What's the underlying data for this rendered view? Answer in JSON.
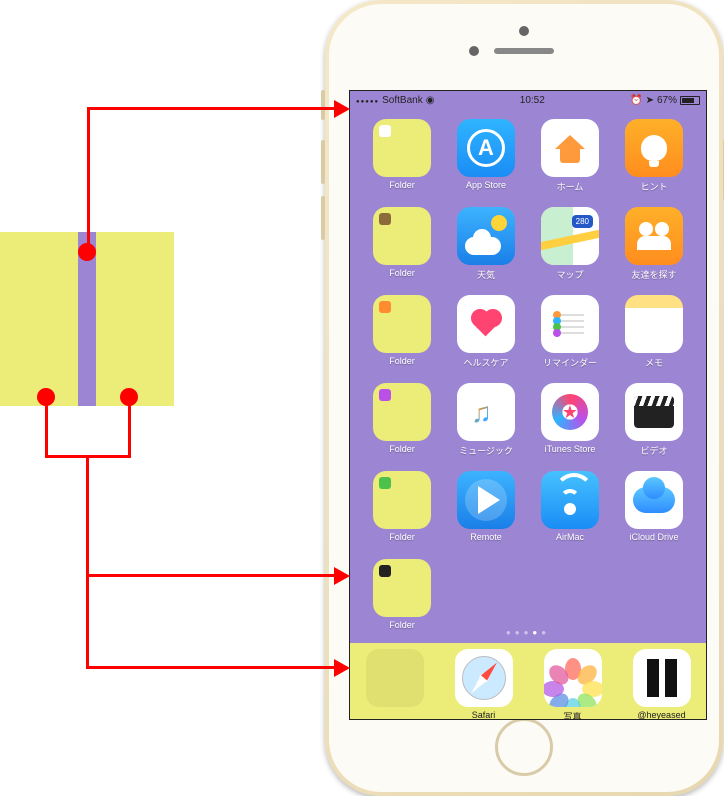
{
  "colors": {
    "accent_bg": "#9c86d3",
    "dock_bg": "#ecec78",
    "arrow": "#ff0000"
  },
  "statusbar": {
    "carrier": "SoftBank",
    "time": "10:52",
    "battery_pct": "67%"
  },
  "grid": [
    [
      {
        "label": "Folder",
        "type": "folder",
        "mini": "white"
      },
      {
        "label": "App Store",
        "type": "appstore"
      },
      {
        "label": "ホーム",
        "type": "home"
      },
      {
        "label": "ヒント",
        "type": "tips"
      }
    ],
    [
      {
        "label": "Folder",
        "type": "folder",
        "mini": "brown"
      },
      {
        "label": "天気",
        "type": "weather"
      },
      {
        "label": "マップ",
        "type": "maps"
      },
      {
        "label": "友達を探す",
        "type": "friends"
      }
    ],
    [
      {
        "label": "Folder",
        "type": "folder",
        "mini": "orange"
      },
      {
        "label": "ヘルスケア",
        "type": "health"
      },
      {
        "label": "リマインダー",
        "type": "reminders"
      },
      {
        "label": "メモ",
        "type": "notes"
      }
    ],
    [
      {
        "label": "Folder",
        "type": "folder",
        "mini": "purple"
      },
      {
        "label": "ミュージック",
        "type": "music"
      },
      {
        "label": "iTunes Store",
        "type": "itunes"
      },
      {
        "label": "ビデオ",
        "type": "videos"
      }
    ],
    [
      {
        "label": "Folder",
        "type": "folder",
        "mini": "green"
      },
      {
        "label": "Remote",
        "type": "remote"
      },
      {
        "label": "AirMac",
        "type": "airmac"
      },
      {
        "label": "iCloud Drive",
        "type": "icloud"
      }
    ],
    [
      {
        "label": "Folder",
        "type": "folder",
        "mini": "dark"
      },
      null,
      null,
      null
    ]
  ],
  "dock": [
    {
      "label": "",
      "type": "dockfolder"
    },
    {
      "label": "Safari",
      "type": "safari"
    },
    {
      "label": "写真",
      "type": "photos"
    },
    {
      "label": "@heyeased",
      "type": "heyeased"
    }
  ],
  "page_indicator": {
    "total": 5,
    "current": 4
  }
}
